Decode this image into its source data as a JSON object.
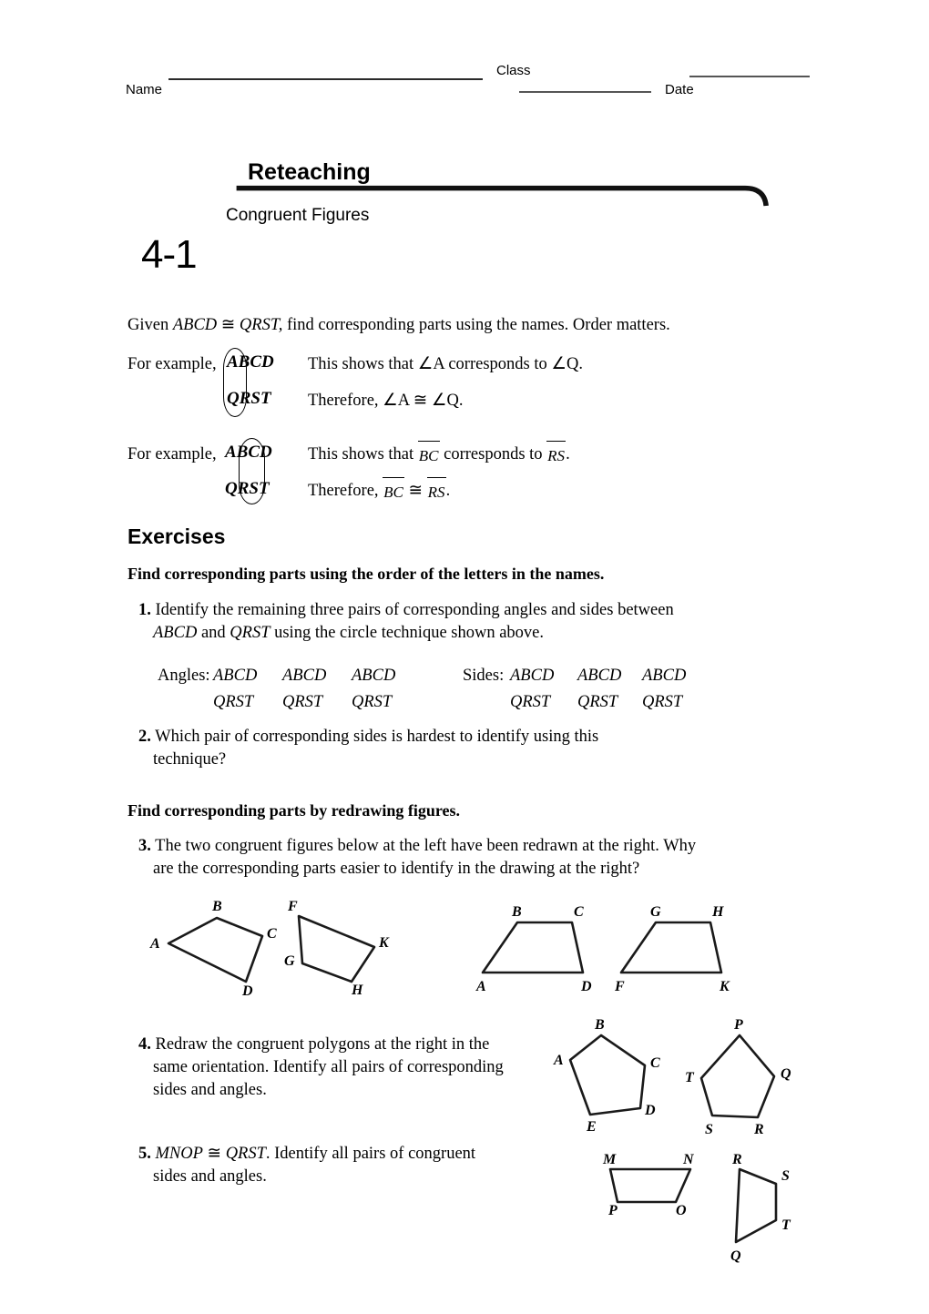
{
  "header": {
    "name_label": "Name",
    "class_label": "Class",
    "date_label": "Date"
  },
  "title": {
    "lesson_number": "4-1",
    "heading": "Reteaching",
    "subtitle": "Congruent Figures"
  },
  "intro": {
    "given_pre": "Given ",
    "given_fig1": "ABCD",
    "given_cong": " ≅ ",
    "given_fig2": "QRST,",
    "given_post": " find corresponding parts using the names. Order matters."
  },
  "example1": {
    "lead": "For example,",
    "top_name": "ABCD",
    "bottom_name": "QRST",
    "shows_pre": "This shows that ",
    "shows_angle1": "∠A",
    "shows_mid": " corresponds to ",
    "shows_angle2": "∠Q",
    "shows_end": ".",
    "therefore_pre": "Therefore, ",
    "therefore_angle1": "∠A",
    "therefore_cong": " ≅ ",
    "therefore_angle2": "∠Q",
    "therefore_end": "."
  },
  "example2": {
    "lead": "For example,",
    "top_name": "ABCD",
    "bottom_name": "QRST",
    "shows_pre": "This shows that ",
    "shows_seg1": "BC",
    "shows_mid": " corresponds to ",
    "shows_seg2": "RS",
    "shows_end": ".",
    "therefore_pre": "Therefore, ",
    "therefore_seg1": "BC",
    "therefore_cong": " ≅ ",
    "therefore_seg2": "RS",
    "therefore_end": "."
  },
  "exercises": {
    "heading": "Exercises",
    "direction_1": "Find corresponding parts using the order of the letters in the names.",
    "direction_2": "Find corresponding parts by redrawing figures."
  },
  "q1": {
    "num": "1.",
    "line1": "Identify the remaining three pairs of corresponding angles and sides between",
    "line2_fig1": "ABCD",
    "line2_mid": " and ",
    "line2_fig2": "QRST",
    "line2_post": " using the circle technique shown above."
  },
  "answer_table": {
    "angles_label": "Angles:",
    "sides_label": "Sides:",
    "top_name": "ABCD",
    "bottom_name": "QRST",
    "angles_top": [
      "ABCD",
      "ABCD",
      "ABCD"
    ],
    "angles_bottom": [
      "QRST",
      "QRST",
      "QRST"
    ],
    "sides_top": [
      "ABCD",
      "ABCD",
      "ABCD"
    ],
    "sides_bottom": [
      "QRST",
      "QRST",
      "QRST"
    ]
  },
  "q2": {
    "num": "2.",
    "line1": "Which pair of corresponding sides is hardest to identify using this",
    "line2": "technique?"
  },
  "q3": {
    "num": "3.",
    "line1": "The two congruent figures below at the left have been redrawn at the right. Why",
    "line2": "are the corresponding parts easier to identify in the drawing at the right?",
    "fig_left_1": [
      "A",
      "B",
      "C",
      "D"
    ],
    "fig_left_2": [
      "F",
      "G",
      "H",
      "K"
    ],
    "fig_right_1": [
      "A",
      "B",
      "C",
      "D"
    ],
    "fig_right_2": [
      "F",
      "G",
      "H",
      "K"
    ]
  },
  "q4": {
    "num": "4.",
    "line1": "Redraw the congruent polygons at the right in the",
    "line2": "same orientation. Identify all pairs of corresponding",
    "line3": "sides and angles.",
    "pentagon_1": [
      "A",
      "B",
      "C",
      "D",
      "E"
    ],
    "pentagon_2": [
      "P",
      "Q",
      "R",
      "S",
      "T"
    ]
  },
  "q5": {
    "num": "5.",
    "fig1": "MNOP",
    "cong": " ≅ ",
    "fig2": "QRST",
    "line1_post": ". Identify all pairs of congruent",
    "line2": "sides and angles.",
    "trapezoid_1": [
      "M",
      "N",
      "O",
      "P"
    ],
    "trapezoid_2": [
      "Q",
      "R",
      "S",
      "T"
    ]
  },
  "colors": {
    "ink": "#000000",
    "rule": "#111111",
    "gray_line": "#555555"
  }
}
